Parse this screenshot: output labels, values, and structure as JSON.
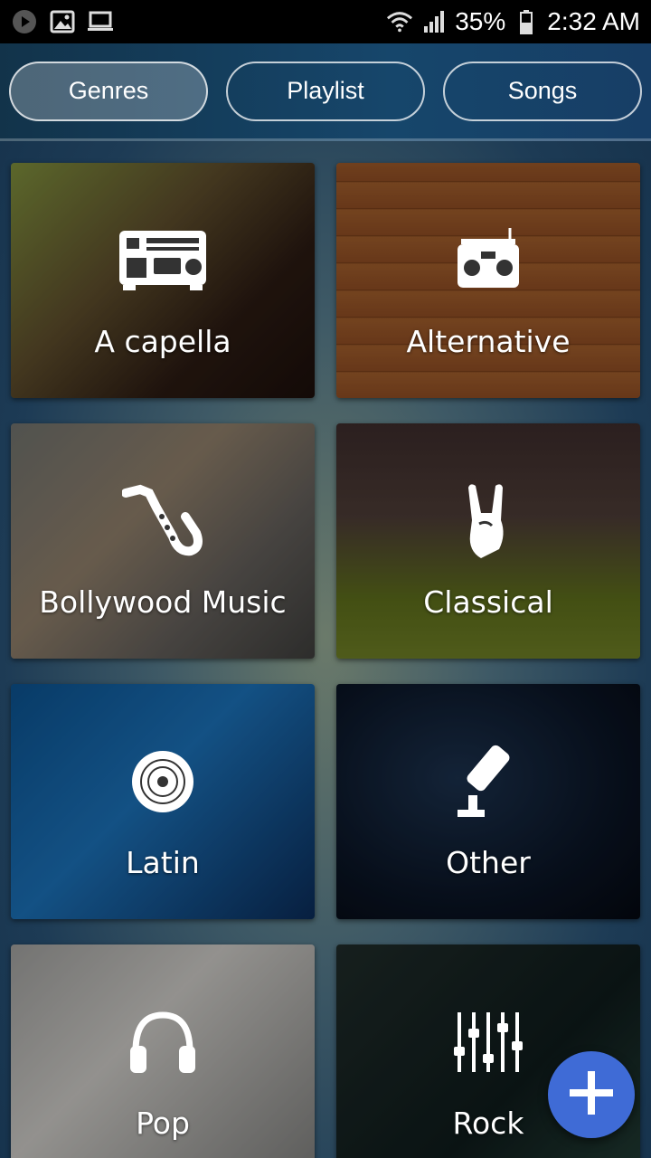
{
  "status_bar": {
    "left_icons": [
      "play-icon",
      "image-icon",
      "laptop-icon"
    ],
    "signal_icons": [
      "wifi-icon",
      "signal-icon",
      "battery-icon"
    ],
    "battery": "35%",
    "time": "2:32 AM"
  },
  "tabs": [
    {
      "label": "Genres",
      "active": true
    },
    {
      "label": "Playlist",
      "active": false
    },
    {
      "label": "Songs",
      "active": false
    }
  ],
  "genres": [
    {
      "label": "A capella",
      "icon": "stereo-icon"
    },
    {
      "label": "Alternative",
      "icon": "boombox-icon"
    },
    {
      "label": "Bollywood Music",
      "icon": "saxophone-icon"
    },
    {
      "label": "Classical",
      "icon": "rock-hand-icon"
    },
    {
      "label": "Latin",
      "icon": "vinyl-disc-icon"
    },
    {
      "label": "Other",
      "icon": "microphone-icon"
    },
    {
      "label": "Pop",
      "icon": "headphones-icon"
    },
    {
      "label": "Rock",
      "icon": "mixer-sliders-icon"
    }
  ],
  "fab": {
    "icon": "plus-icon",
    "color": "#3f6bd6"
  }
}
